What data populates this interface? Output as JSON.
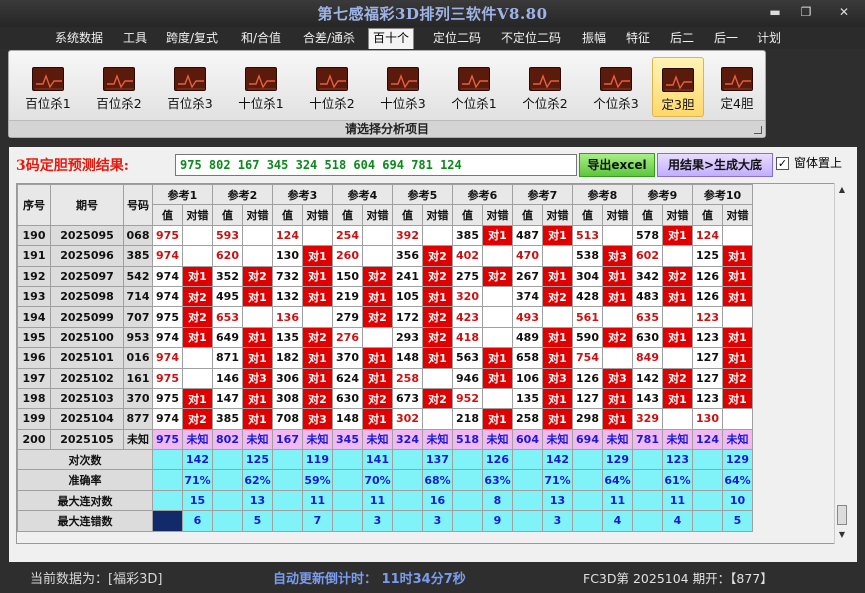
{
  "window": {
    "title": "第七感福彩3D排列三软件V8.80"
  },
  "menu": [
    "系统数据",
    "工具",
    "跨度/复式",
    "和/合值",
    "合差/通杀",
    "百十个",
    "定位二码",
    "不定位二码",
    "振幅",
    "特征",
    "后二",
    "后一",
    "计划"
  ],
  "menu_active": "百十个",
  "ribbon": {
    "buttons": [
      "百位杀1",
      "百位杀2",
      "百位杀3",
      "十位杀1",
      "十位杀2",
      "十位杀3",
      "个位杀1",
      "个位杀2",
      "个位杀3",
      "定3胆",
      "定4胆"
    ],
    "active": "定3胆",
    "icon": "chart-line-icon",
    "caption": "请选择分析项目"
  },
  "result": {
    "label": "3码定胆预测结果:",
    "value": "975 802 167 345 324 518 604 694 781 124",
    "export_button": "导出excel",
    "generate_button": "用结果>生成大底",
    "checkbox_label": "窗体置上",
    "checkbox_checked": true
  },
  "grid": {
    "headers": {
      "idx": "序号",
      "period": "期号",
      "number": "号码",
      "ref_prefix": "参考",
      "value": "值",
      "match": "对错"
    },
    "ref_count": 10,
    "rows": [
      {
        "idx": "190",
        "period": "2025095",
        "number": "068",
        "cells": [
          [
            "975",
            "",
            1
          ],
          [
            "593",
            "",
            1
          ],
          [
            "124",
            "",
            1
          ],
          [
            "254",
            "",
            1
          ],
          [
            "392",
            "",
            1
          ],
          [
            "385",
            "对1",
            0
          ],
          [
            "487",
            "对1",
            0
          ],
          [
            "513",
            "",
            1
          ],
          [
            "578",
            "对1",
            0
          ],
          [
            "124",
            "",
            1
          ]
        ]
      },
      {
        "idx": "191",
        "period": "2025096",
        "number": "385",
        "cells": [
          [
            "974",
            "",
            1
          ],
          [
            "620",
            "",
            1
          ],
          [
            "130",
            "对1",
            0
          ],
          [
            "260",
            "",
            1
          ],
          [
            "356",
            "对2",
            0
          ],
          [
            "402",
            "",
            1
          ],
          [
            "470",
            "",
            1
          ],
          [
            "538",
            "对3",
            0
          ],
          [
            "602",
            "",
            1
          ],
          [
            "125",
            "对1",
            0
          ]
        ]
      },
      {
        "idx": "192",
        "period": "2025097",
        "number": "542",
        "cells": [
          [
            "974",
            "对1",
            0
          ],
          [
            "352",
            "对2",
            0
          ],
          [
            "732",
            "对1",
            0
          ],
          [
            "150",
            "对2",
            0
          ],
          [
            "241",
            "对2",
            0
          ],
          [
            "275",
            "对2",
            0
          ],
          [
            "267",
            "对1",
            0
          ],
          [
            "304",
            "对1",
            0
          ],
          [
            "342",
            "对2",
            0
          ],
          [
            "126",
            "对1",
            0
          ]
        ]
      },
      {
        "idx": "193",
        "period": "2025098",
        "number": "714",
        "cells": [
          [
            "974",
            "对2",
            0
          ],
          [
            "495",
            "对1",
            0
          ],
          [
            "132",
            "对1",
            0
          ],
          [
            "219",
            "对1",
            0
          ],
          [
            "105",
            "对1",
            0
          ],
          [
            "320",
            "",
            1
          ],
          [
            "374",
            "对2",
            0
          ],
          [
            "428",
            "对1",
            0
          ],
          [
            "483",
            "对1",
            0
          ],
          [
            "126",
            "对1",
            0
          ]
        ]
      },
      {
        "idx": "194",
        "period": "2025099",
        "number": "707",
        "cells": [
          [
            "975",
            "对2",
            0
          ],
          [
            "653",
            "",
            1
          ],
          [
            "136",
            "",
            1
          ],
          [
            "279",
            "对2",
            0
          ],
          [
            "172",
            "对2",
            0
          ],
          [
            "423",
            "",
            1
          ],
          [
            "493",
            "",
            1
          ],
          [
            "561",
            "",
            1
          ],
          [
            "635",
            "",
            1
          ],
          [
            "123",
            "",
            1
          ]
        ]
      },
      {
        "idx": "195",
        "period": "2025100",
        "number": "953",
        "cells": [
          [
            "974",
            "对1",
            0
          ],
          [
            "649",
            "对1",
            0
          ],
          [
            "135",
            "对2",
            0
          ],
          [
            "276",
            "",
            1
          ],
          [
            "293",
            "对2",
            0
          ],
          [
            "418",
            "",
            1
          ],
          [
            "489",
            "对1",
            0
          ],
          [
            "590",
            "对2",
            0
          ],
          [
            "630",
            "对1",
            0
          ],
          [
            "123",
            "对1",
            0
          ]
        ]
      },
      {
        "idx": "196",
        "period": "2025101",
        "number": "016",
        "cells": [
          [
            "974",
            "",
            1
          ],
          [
            "871",
            "对1",
            0
          ],
          [
            "182",
            "对1",
            0
          ],
          [
            "370",
            "对1",
            0
          ],
          [
            "148",
            "对1",
            0
          ],
          [
            "563",
            "对1",
            0
          ],
          [
            "658",
            "对1",
            0
          ],
          [
            "754",
            "",
            1
          ],
          [
            "849",
            "",
            1
          ],
          [
            "127",
            "对1",
            0
          ]
        ]
      },
      {
        "idx": "197",
        "period": "2025102",
        "number": "161",
        "cells": [
          [
            "975",
            "",
            1
          ],
          [
            "146",
            "对3",
            0
          ],
          [
            "306",
            "对1",
            0
          ],
          [
            "624",
            "对1",
            0
          ],
          [
            "258",
            "",
            1
          ],
          [
            "946",
            "对1",
            0
          ],
          [
            "106",
            "对3",
            0
          ],
          [
            "126",
            "对3",
            0
          ],
          [
            "142",
            "对2",
            0
          ],
          [
            "127",
            "对2",
            0
          ]
        ]
      },
      {
        "idx": "198",
        "period": "2025103",
        "number": "370",
        "cells": [
          [
            "975",
            "对1",
            0
          ],
          [
            "147",
            "对1",
            0
          ],
          [
            "308",
            "对2",
            0
          ],
          [
            "630",
            "对2",
            0
          ],
          [
            "673",
            "对2",
            0
          ],
          [
            "952",
            "",
            1
          ],
          [
            "135",
            "对1",
            0
          ],
          [
            "127",
            "对1",
            0
          ],
          [
            "143",
            "对1",
            0
          ],
          [
            "123",
            "对1",
            0
          ]
        ]
      },
      {
        "idx": "199",
        "period": "2025104",
        "number": "877",
        "cells": [
          [
            "974",
            "对2",
            0
          ],
          [
            "385",
            "对1",
            0
          ],
          [
            "708",
            "对3",
            0
          ],
          [
            "148",
            "对1",
            0
          ],
          [
            "302",
            "",
            1
          ],
          [
            "218",
            "对1",
            0
          ],
          [
            "258",
            "对1",
            0
          ],
          [
            "298",
            "对1",
            0
          ],
          [
            "329",
            "",
            1
          ],
          [
            "130",
            "",
            1
          ]
        ]
      }
    ],
    "pending_row": {
      "idx": "200",
      "period": "2025105",
      "number": "未知",
      "cells": [
        [
          "975",
          "未知"
        ],
        [
          "802",
          "未知"
        ],
        [
          "167",
          "未知"
        ],
        [
          "345",
          "未知"
        ],
        [
          "324",
          "未知"
        ],
        [
          "518",
          "未知"
        ],
        [
          "604",
          "未知"
        ],
        [
          "694",
          "未知"
        ],
        [
          "781",
          "未知"
        ],
        [
          "124",
          "未知"
        ]
      ]
    },
    "stats": [
      {
        "label": "对次数",
        "values": [
          "142",
          "125",
          "119",
          "141",
          "137",
          "126",
          "142",
          "129",
          "123",
          "129"
        ]
      },
      {
        "label": "准确率",
        "values": [
          "71%",
          "62%",
          "59%",
          "70%",
          "68%",
          "63%",
          "71%",
          "64%",
          "61%",
          "64%"
        ]
      },
      {
        "label": "最大连对数",
        "values": [
          "15",
          "13",
          "11",
          "11",
          "16",
          "8",
          "13",
          "11",
          "11",
          "10"
        ]
      },
      {
        "label": "最大连错数",
        "values": [
          "6",
          "5",
          "7",
          "3",
          "3",
          "9",
          "3",
          "4",
          "4",
          "5"
        ]
      }
    ]
  },
  "status": {
    "current_data": "当前数据为：[福彩3D]",
    "countdown": "自动更新倒计时：  11时34分7秒",
    "draw_info": "FC3D第 2025104 期开：【877】"
  },
  "colors": {
    "hit": "#e00000",
    "pending": "#f2b8f2",
    "stats": "#7ff3f8",
    "accent_value": "#cc1111"
  }
}
